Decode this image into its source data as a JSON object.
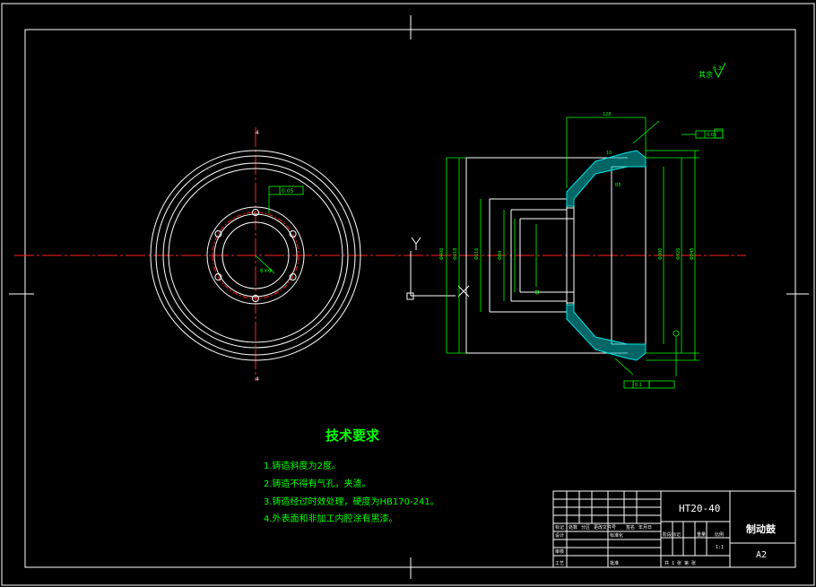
{
  "drawing": {
    "roughness_note": "其余",
    "roughness_value": "6.3",
    "axis_y_label": "Y",
    "axis_x_label": "X",
    "left_view_labels": {
      "top": "4",
      "bottom": "4",
      "tolerance_box": "0.05",
      "pcd_dim": "6×Φ"
    },
    "section_dims": {
      "top_length": "128",
      "tol_top_right": "0.05",
      "tol_bottom_right": "0.1",
      "left_dia": "Φ400",
      "dia_1": "Φ318",
      "dia_2": "Φ116",
      "dia_3": "Φ84",
      "dia_4": "Φ300",
      "dia_5": "Φ326",
      "dia_6": "Φ345",
      "small_1": "10",
      "small_2": "R5"
    }
  },
  "tech": {
    "title": "技术要求",
    "items": [
      "1.铸造斜度为2度。",
      "2.铸造不得有气孔，夹渣。",
      "3.铸造经过时效处理，硬度为HB170-241。",
      "4.外表面和非加工内腔涂有黑漆。"
    ]
  },
  "title_block": {
    "material": "HT20-40",
    "part_name": "制动鼓",
    "sheet_size": "A2",
    "scale": "1:1",
    "row_labels": [
      "标记",
      "处数",
      "分区",
      "更改文件号",
      "签名",
      "年月日"
    ],
    "design": "设计",
    "standardize": "标准化",
    "review": "审核",
    "process": "工艺",
    "approve": "批准",
    "stage_label": "阶段标记",
    "weight_label": "重量",
    "scale_label": "比例",
    "sheets": "共 1 张  第  张"
  },
  "colors": {
    "background": "#000000",
    "line": "#ffffff",
    "center_line": "#ff2020",
    "dimension": "#00ff00",
    "hatch": "#00e5e5",
    "text_green": "#00ff00"
  }
}
